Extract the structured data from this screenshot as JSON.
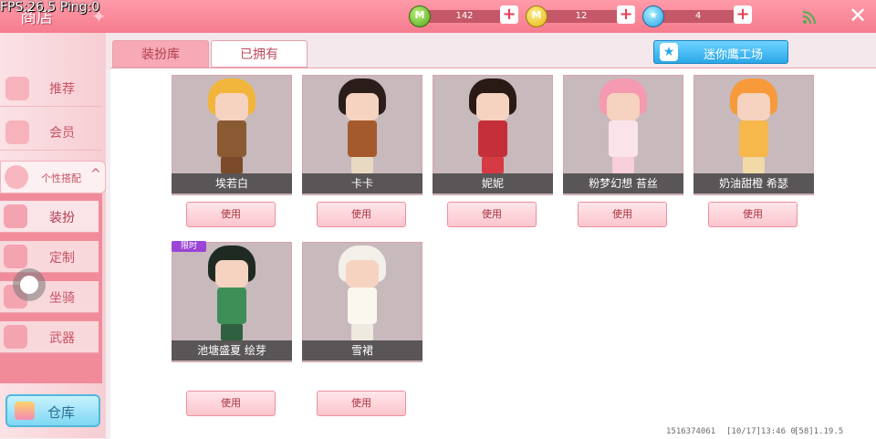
{
  "hud": {
    "fps_text": "FPS:26.5 Ping:0"
  },
  "header": {
    "title": "商店",
    "currencies": [
      {
        "name": "green-gem",
        "value": "142",
        "icon_letter": "M",
        "color": "#4ea61c"
      },
      {
        "name": "gold-coin",
        "value": "12",
        "icon_letter": "M",
        "color": "#e2b411"
      },
      {
        "name": "blue-star",
        "value": "4",
        "icon_letter": "★",
        "color": "#2aa2e4"
      }
    ],
    "plus_label": "+",
    "close_label": "✕"
  },
  "sidebar": {
    "items": [
      {
        "label": "推荐"
      },
      {
        "label": "会员"
      }
    ],
    "personalize": {
      "label": "个性搭配",
      "chevron": "^"
    },
    "sub_items": [
      {
        "label": "装扮",
        "selected": true
      },
      {
        "label": "定制",
        "selected": false
      },
      {
        "label": "坐骑",
        "selected": false
      },
      {
        "label": "武器",
        "selected": false
      }
    ],
    "warehouse_label": "仓库"
  },
  "tabs": [
    {
      "label": "装扮库",
      "active": false
    },
    {
      "label": "已拥有",
      "active": true
    }
  ],
  "workshop_label": "迷你鹰工场",
  "outfits": [
    {
      "name": "埃若白",
      "button": "使用",
      "hair": "#f2b53c",
      "outfit": "#8a5a33",
      "legs": "#7a4a2a",
      "limited": false
    },
    {
      "name": "卡卡",
      "button": "使用",
      "hair": "#2b1d1a",
      "outfit": "#a55a2e",
      "legs": "#e8d9c2",
      "limited": false
    },
    {
      "name": "妮妮",
      "button": "使用",
      "hair": "#2a1a15",
      "outfit": "#c52f3a",
      "legs": "#d63a44",
      "limited": false
    },
    {
      "name": "粉梦幻想 苔丝",
      "button": "使用",
      "hair": "#f59ab0",
      "outfit": "#fbe3ea",
      "legs": "#f7cfd8",
      "limited": false
    },
    {
      "name": "奶油甜橙 希瑟",
      "button": "使用",
      "hair": "#f79a3c",
      "outfit": "#f6b84a",
      "legs": "#f1d9a8",
      "limited": false
    },
    {
      "name": "池塘盛夏 绘芽",
      "button": "使用",
      "hair": "#1f2b22",
      "outfit": "#3e8f57",
      "legs": "#2f6040",
      "limited": true
    },
    {
      "name": "雪裙",
      "button": "使用",
      "hair": "#f2f0e8",
      "outfit": "#faf7ef",
      "legs": "#eeeae0",
      "limited": false
    }
  ],
  "limited_label": "限时",
  "footer": {
    "uid": "1516374061",
    "time": "[10/17]13:46 0",
    "server": "[58]1.19.5"
  }
}
